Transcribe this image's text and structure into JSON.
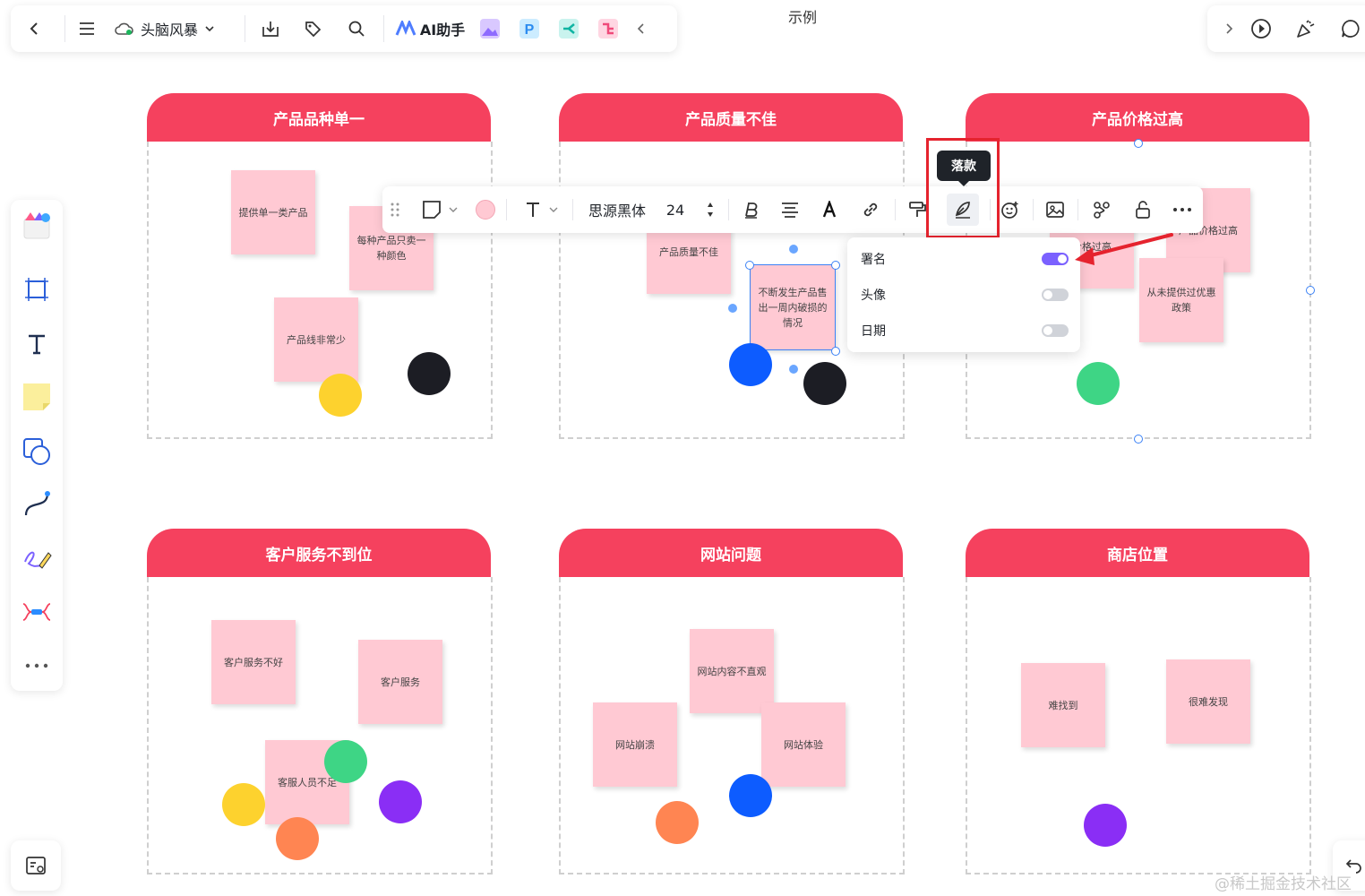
{
  "toolbar": {
    "back_icon": "chevron-left-icon",
    "menu_icon": "hamburger-icon",
    "doc_mode_label": "头脑风暴",
    "ai_label": "AI助手"
  },
  "doc_title": "示例",
  "frames": [
    {
      "title": "产品品种单一",
      "stickies": [
        "提供单一类产品",
        "每种产品只卖一种颜色",
        "产品线非常少"
      ]
    },
    {
      "title": "产品质量不佳",
      "stickies": [
        "产品质量不佳",
        "不断发生产品售出一周内破损的情况"
      ]
    },
    {
      "title": "产品价格过高",
      "stickies": [
        "价格过高",
        "产品价格过高",
        "从未提供过优惠政策"
      ]
    },
    {
      "title": "客户服务不到位",
      "stickies": [
        "客户服务不好",
        "客户服务",
        "客服人员不足"
      ]
    },
    {
      "title": "网站问题",
      "stickies": [
        "网站内容不直观",
        "网站崩溃",
        "网站体验"
      ]
    },
    {
      "title": "商店位置",
      "stickies": [
        "难找到",
        "很难发现"
      ]
    }
  ],
  "format_toolbar": {
    "font_family": "思源黑体",
    "font_size": "24",
    "fill_color": "#ffc9d3"
  },
  "tooltip": "落款",
  "signature_popup": {
    "rows": [
      {
        "label": "署名",
        "on": true
      },
      {
        "label": "头像",
        "on": false
      },
      {
        "label": "日期",
        "on": false
      }
    ]
  },
  "colors": {
    "header": "#f5415e",
    "sticky": "#ffc9d3",
    "toggle_on": "#7b61ff",
    "highlight": "#e5232e"
  },
  "watermark": "@稀土掘金技术社区"
}
